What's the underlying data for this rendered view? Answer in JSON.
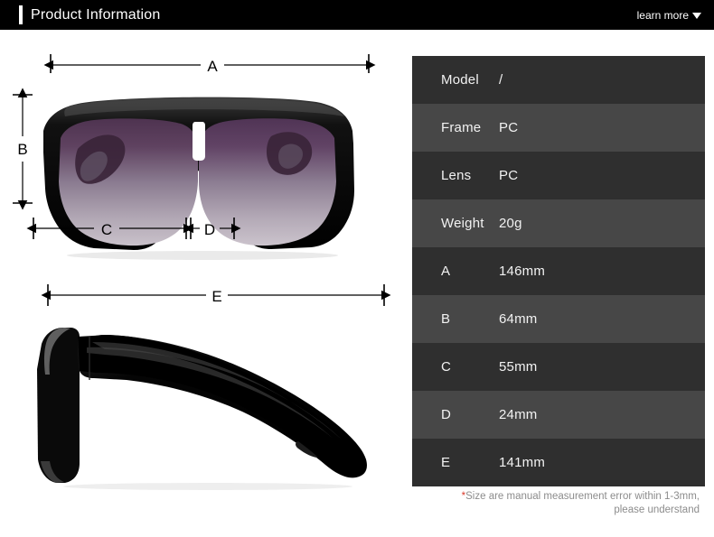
{
  "header": {
    "title": "Product Information",
    "learn_more_label": "learn more",
    "caret_icon": "chevron-down-icon",
    "accent_color": "#ffffff",
    "background_color": "#000000"
  },
  "diagram": {
    "front_view": {
      "alt": "Front view of oversized black sunglasses with purple gradient lenses",
      "frame_color": "#0d0d0d",
      "lens_gradient_top": "#5d3f5c",
      "lens_gradient_bottom": "#c0b6c1"
    },
    "side_view": {
      "alt": "Side view of black sunglasses temple arm",
      "frame_color": "#0d0d0d"
    },
    "dimension_labels": {
      "a": "A",
      "b": "B",
      "c": "C",
      "d": "D",
      "e": "E"
    }
  },
  "spec_table": {
    "rows": [
      {
        "label": "Model",
        "value": "/"
      },
      {
        "label": "Frame",
        "value": "PC"
      },
      {
        "label": "Lens",
        "value": "PC"
      },
      {
        "label": "Weight",
        "value": "20g"
      },
      {
        "label": "A",
        "value": "146mm"
      },
      {
        "label": "B",
        "value": "64mm"
      },
      {
        "label": "C",
        "value": "55mm"
      },
      {
        "label": "D",
        "value": "24mm"
      },
      {
        "label": "E",
        "value": "141mm"
      }
    ],
    "row_color_odd": "#2f2f2f",
    "row_color_even": "#474747",
    "text_color": "#f2f2f2"
  },
  "note": {
    "asterisk": "*",
    "line1": "Size are manual measurement error within 1-3mm,",
    "line2": "please understand",
    "asterisk_color": "#d93a2b",
    "text_color": "#8c8c8c"
  }
}
